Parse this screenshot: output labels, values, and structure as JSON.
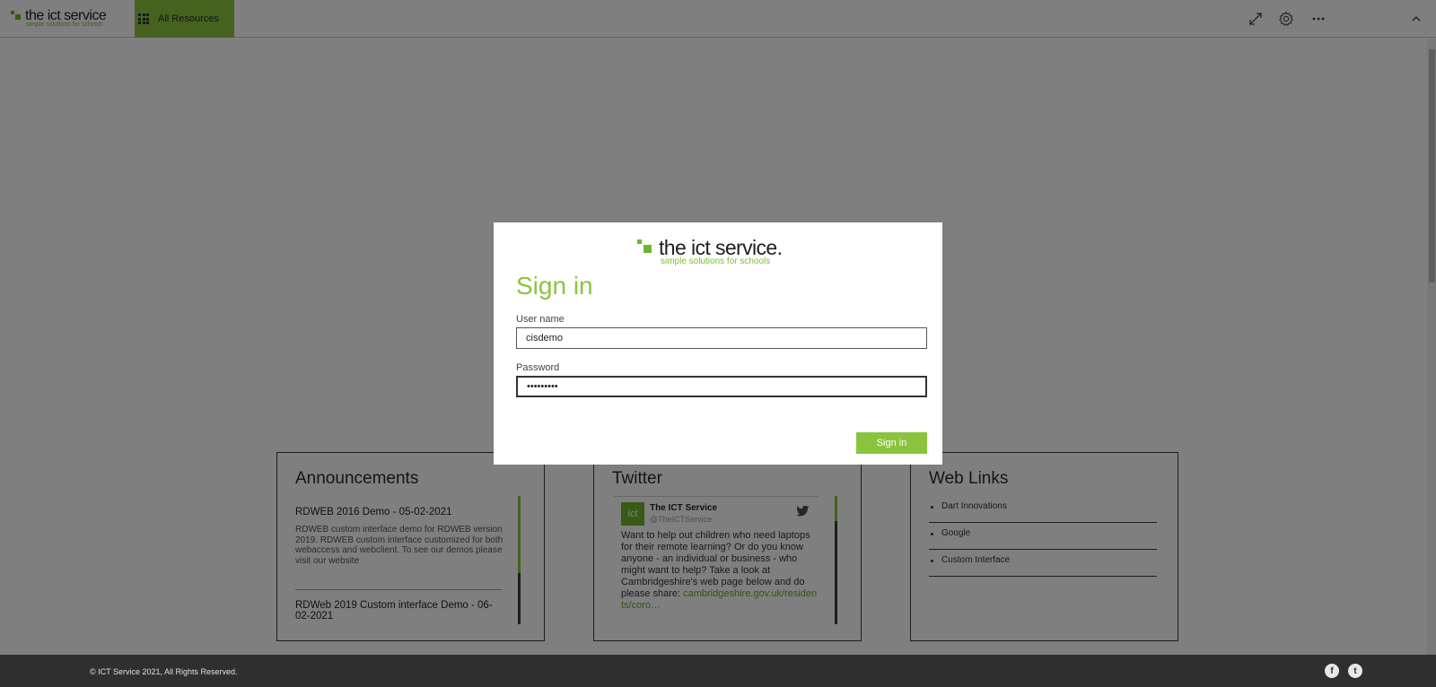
{
  "topbar": {
    "brand_name": "the ict service",
    "brand_tagline": "simple solutions for schools",
    "all_resources_label": "All Resources",
    "icons": [
      "expand-icon",
      "gear-icon",
      "more-icon",
      "chevron-up-icon"
    ]
  },
  "announcements": {
    "title": "Announcements",
    "items": [
      {
        "title": "RDWEB 2016 Demo - 05-02-2021",
        "body": "RDWEB custom interface demo for RDWEB version 2019. RDWEB custom interface customized for both webaccess and webclient. To see our demos please visit our website"
      },
      {
        "title": "RDWeb 2019 Custom interface Demo - 06-02-2021",
        "body": ""
      }
    ]
  },
  "twitter": {
    "title": "Twitter",
    "avatar_text": "ict",
    "account_name": "The ICT Service",
    "handle": "@TheICTService",
    "tweet_text": "Want to help out children who need laptops for their remote learning? Or do you know anyone - an individual or business - who might want to help? Take a look at Cambridgeshire's web page below and do please share: ",
    "tweet_link": "cambridgeshire.gov.uk/residents/coro…"
  },
  "web_links": {
    "title": "Web Links",
    "items": [
      "Dart Innovations",
      "Google",
      "Custom Interface"
    ]
  },
  "footer": {
    "copyright": "© ICT Service 2021, All Rights Reserved.",
    "facebook_glyph": "f",
    "twitter_glyph": "t"
  },
  "signin_modal": {
    "logo_name": "the ict service.",
    "logo_tagline": "simple solutions for schools",
    "title": "Sign in",
    "username_label": "User name",
    "username_value": "cisdemo",
    "password_label": "Password",
    "password_value": "•••••••••",
    "submit_label": "Sign in"
  },
  "colors": {
    "accent": "#8ac43f",
    "brand_green": "#6fb52c",
    "footer_bg": "#2f2f2f",
    "overlay": "rgba(0,0,0,0.5)"
  }
}
